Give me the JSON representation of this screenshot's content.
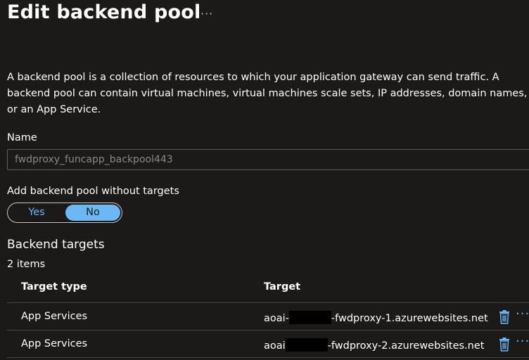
{
  "header": {
    "title": "Edit backend pool",
    "more_label": "···"
  },
  "description": "A backend pool is a collection of resources to which your application gateway can send traffic. A backend pool can contain virtual machines, virtual machines scale sets, IP addresses, domain names, or an App Service.",
  "form": {
    "name_label": "Name",
    "name_value": "fwdproxy_funcapp_backpool443",
    "toggle_label": "Add backend pool without targets",
    "toggle_yes": "Yes",
    "toggle_no": "No",
    "toggle_selected": "No"
  },
  "targets": {
    "title": "Backend targets",
    "count": "2 items",
    "columns": [
      "Target type",
      "Target"
    ],
    "rows": [
      {
        "type": "App Services",
        "target_prefix": "aoai-",
        "target_suffix": "-fwdproxy-1.azurewebsites.net"
      },
      {
        "type": "App Services",
        "target_prefix": "aoai",
        "target_suffix": "-fwdproxy-2.azurewebsites.net"
      }
    ],
    "row_more_label": "···"
  },
  "colors": {
    "background": "#1b1a19",
    "accent": "#6cb8f6",
    "border": "#484644"
  },
  "icons": {
    "delete": "trash-icon",
    "more": "more-icon"
  }
}
